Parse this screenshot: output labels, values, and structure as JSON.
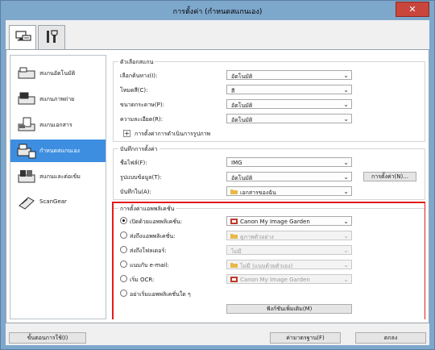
{
  "window": {
    "title": "การตั้งค่า (กำหนดสแกนเอง)",
    "close_glyph": "✕"
  },
  "tabs": [
    {
      "icon": "scanner-computer-icon"
    },
    {
      "icon": "tools-icon"
    }
  ],
  "sidebar": {
    "items": [
      {
        "label": "สแกนอัตโนมัติ",
        "icon": "auto-scan-icon"
      },
      {
        "label": "สแกนภาพถ่าย",
        "icon": "photo-scan-icon"
      },
      {
        "label": "สแกนเอกสาร",
        "icon": "document-scan-icon"
      },
      {
        "label": "กำหนดสแกนเอง",
        "icon": "custom-scan-icon",
        "active": true
      },
      {
        "label": "สแกนและต่อเข้ม",
        "icon": "stitch-scan-icon"
      },
      {
        "label": "ScanGear",
        "icon": "scangear-icon"
      }
    ]
  },
  "scan_options": {
    "title": "ตัวเลือกสแกน",
    "rows": [
      {
        "label": "เลือกต้นทาง(I):",
        "value": "อัตโนมัติ"
      },
      {
        "label": "โหมดสี(C):",
        "value": "สี"
      },
      {
        "label": "ขนาดกระดาษ(P):",
        "value": "อัตโนมัติ"
      },
      {
        "label": "ความละเอียด(R):",
        "value": "อัตโนมัติ"
      }
    ],
    "image_processing_label": "การตั้งค่าการดำเนินการรูปภาพ",
    "plus_glyph": "+"
  },
  "save_settings": {
    "title": "บันทึกการตั้งค่า",
    "file_name_label": "ชื่อไฟล์(F):",
    "file_name_value": "IMG",
    "data_format_label": "รูปแบบข้อมูล(T):",
    "data_format_value": "อัตโนมัติ",
    "settings_button": "การตั้งค่า(N)...",
    "save_in_label": "บันทึกใน(A):",
    "save_in_value": "เอกสารของฉัน"
  },
  "app_settings": {
    "title": "การตั้งค่าแอพพลิเคชั่น",
    "rows": [
      {
        "label": "เปิดด้วยแอพพลิเคชั่น:",
        "value": "Canon My Image Garden",
        "checked": true,
        "disabled": false,
        "icon": "canon-app-icon"
      },
      {
        "label": "ส่งถึงแอพพลิเคชั่น:",
        "value": "ดูภาพตัวอย่าง",
        "checked": false,
        "disabled": true,
        "icon": "folder-icon"
      },
      {
        "label": "ส่งถึงโฟลเดอร์:",
        "value": "ไม่มี",
        "checked": false,
        "disabled": true,
        "icon": ""
      },
      {
        "label": "แนบกับ e-mail:",
        "value": "ไม่มี (แนบด้วยตัวเอง)",
        "checked": false,
        "disabled": true,
        "icon": "folder-icon"
      },
      {
        "label": "เริ่ม OCR:",
        "value": "Canon My Image Garden",
        "checked": false,
        "disabled": true,
        "icon": "canon-app-icon"
      },
      {
        "label": "อย่าเริ่มแอพพลิเคชั่นใด ๆ",
        "value": "",
        "checked": false,
        "disabled": false,
        "icon": ""
      }
    ],
    "more_functions_button": "ฟังก์ชันเพิ่มเติม(M)"
  },
  "footer": {
    "instructions_button": "ขั้นตอนการใช้(I)",
    "defaults_button": "ค่ามาตรฐาน(F)",
    "ok_button": "ตกลง"
  },
  "colors": {
    "titlebar": "#7ea7cc",
    "active_sidebar": "#3d8ee0",
    "highlight_border": "#e21b1b",
    "close_button": "#c9463d"
  }
}
